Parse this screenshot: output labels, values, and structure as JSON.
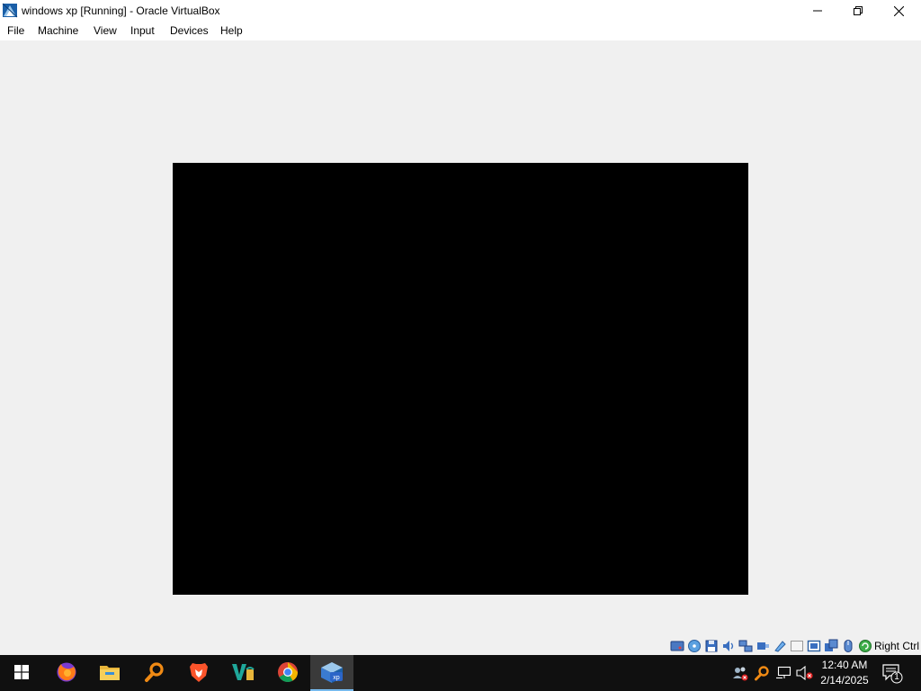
{
  "window": {
    "title": "windows xp [Running] - Oracle VirtualBox",
    "app_icon": "virtualbox-icon",
    "controls": [
      "minimize-icon",
      "restore-icon",
      "close-icon"
    ]
  },
  "menubar": {
    "items": [
      {
        "label": "File"
      },
      {
        "label": "Machine"
      },
      {
        "label": "View"
      },
      {
        "label": "Input"
      },
      {
        "label": "Devices"
      },
      {
        "label": "Help"
      }
    ]
  },
  "vm_display": {
    "color": "#000000"
  },
  "statusbar": {
    "indicators": [
      "hard-disk-icon",
      "optical-drive-icon",
      "floppy-icon",
      "audio-icon",
      "network-icon",
      "usb-icon",
      "shared-folders-icon",
      "display-icon",
      "recording-icon",
      "virtualization-icon",
      "mouse-integration-icon",
      "keyboard-capture-icon"
    ],
    "host_key": "Right Ctrl"
  },
  "taskbar": {
    "start_icon": "windows-start-icon",
    "apps": [
      "firefox-icon",
      "file-explorer-icon",
      "search-magnifier-app-icon",
      "brave-browser-icon",
      "vs-app-icon",
      "chrome-icon",
      "virtualbox-xp-icon"
    ],
    "active_app": "virtualbox-xp-icon",
    "tray": [
      "people-tray-icon",
      "search-tray-icon",
      "network-tray-icon",
      "volume-muted-icon"
    ],
    "clock": {
      "time": "12:40 AM",
      "date": "2/14/2025"
    },
    "notifications": {
      "icon": "notification-icon",
      "count": "1"
    }
  },
  "colors": {
    "titlebar": "#ffffff",
    "client_background": "#f0f0f0",
    "taskbar": "#101010",
    "accent": "#76b9ed"
  }
}
